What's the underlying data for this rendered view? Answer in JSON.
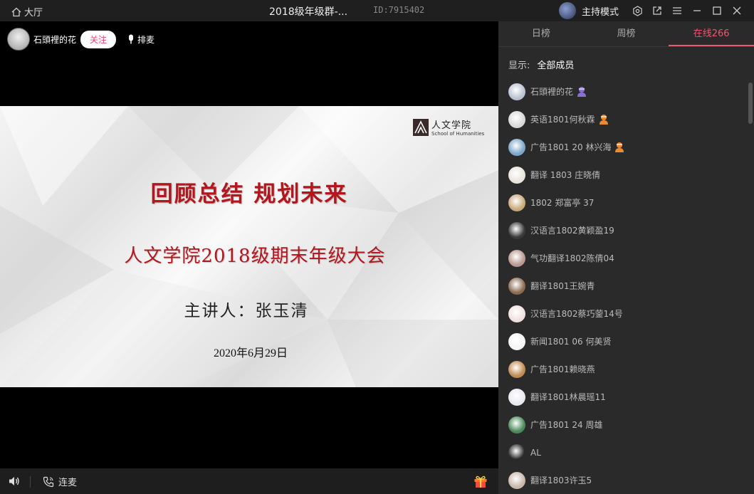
{
  "titlebar": {
    "home_label": "大厅",
    "room_title": "2018级年级群-...",
    "room_id": "ID:7915402",
    "host_mode_label": "主持模式"
  },
  "streamer": {
    "name": "石頭裡的花",
    "follow_label": "关注",
    "mic_queue_label": "排麦"
  },
  "slide": {
    "logo_cn": "人文学院",
    "logo_en": "School of Humanities",
    "title": "回顾总结  规划未来",
    "subtitle": "人文学院2018级期末年级大会",
    "speaker": "主讲人：张玉清",
    "date": "2020年6月29日"
  },
  "controls": {
    "link_mic_label": "连麦"
  },
  "panel": {
    "tabs": [
      {
        "label": "日榜"
      },
      {
        "label": "周榜"
      },
      {
        "label": "在线266"
      }
    ],
    "filter_label": "显示:",
    "filter_value": "全部成员",
    "members": [
      {
        "name": "石頭裡的花",
        "badge": "host",
        "avatar_color": "#b8c2d0"
      },
      {
        "name": "英语1801何秋霖",
        "badge": "admin",
        "avatar_color": "#d8d8d8"
      },
      {
        "name": "广告1801 20 林兴海",
        "badge": "admin",
        "avatar_color": "#7aa6c8"
      },
      {
        "name": "翻译 1803 庄晓倩",
        "badge": "",
        "avatar_color": "#e8e4dc"
      },
      {
        "name": "1802 郑富亭 37",
        "badge": "",
        "avatar_color": "#c9a878"
      },
      {
        "name": "汉语言1802黄颖盈19",
        "badge": "",
        "avatar_color": "#3a3a3a"
      },
      {
        "name": "气功翻译1802陈倩04",
        "badge": "",
        "avatar_color": "#b89890"
      },
      {
        "name": "翻译1801王婉青",
        "badge": "",
        "avatar_color": "#8a6a50"
      },
      {
        "name": "汉语言1802蔡巧蓥14号",
        "badge": "",
        "avatar_color": "#f0e0e0"
      },
      {
        "name": "新闻1801 06 何美贤",
        "badge": "",
        "avatar_color": "#f4f4f4"
      },
      {
        "name": "广告1801赖晓燕",
        "badge": "",
        "avatar_color": "#c08a50"
      },
      {
        "name": "翻译1801林晨瑶11",
        "badge": "",
        "avatar_color": "#e8e8f0"
      },
      {
        "name": "广告1801 24 周雄",
        "badge": "",
        "avatar_color": "#4a8a5a"
      },
      {
        "name": "AL",
        "badge": "",
        "avatar_color": "#2a2a2a"
      },
      {
        "name": "翻译1803许玉5",
        "badge": "",
        "avatar_color": "#c8b8a8"
      }
    ]
  },
  "colors": {
    "accent": "#f0566f",
    "slide_red": "#b3161d",
    "host_badge": "#8b6fd6",
    "admin_badge": "#f0892d"
  }
}
